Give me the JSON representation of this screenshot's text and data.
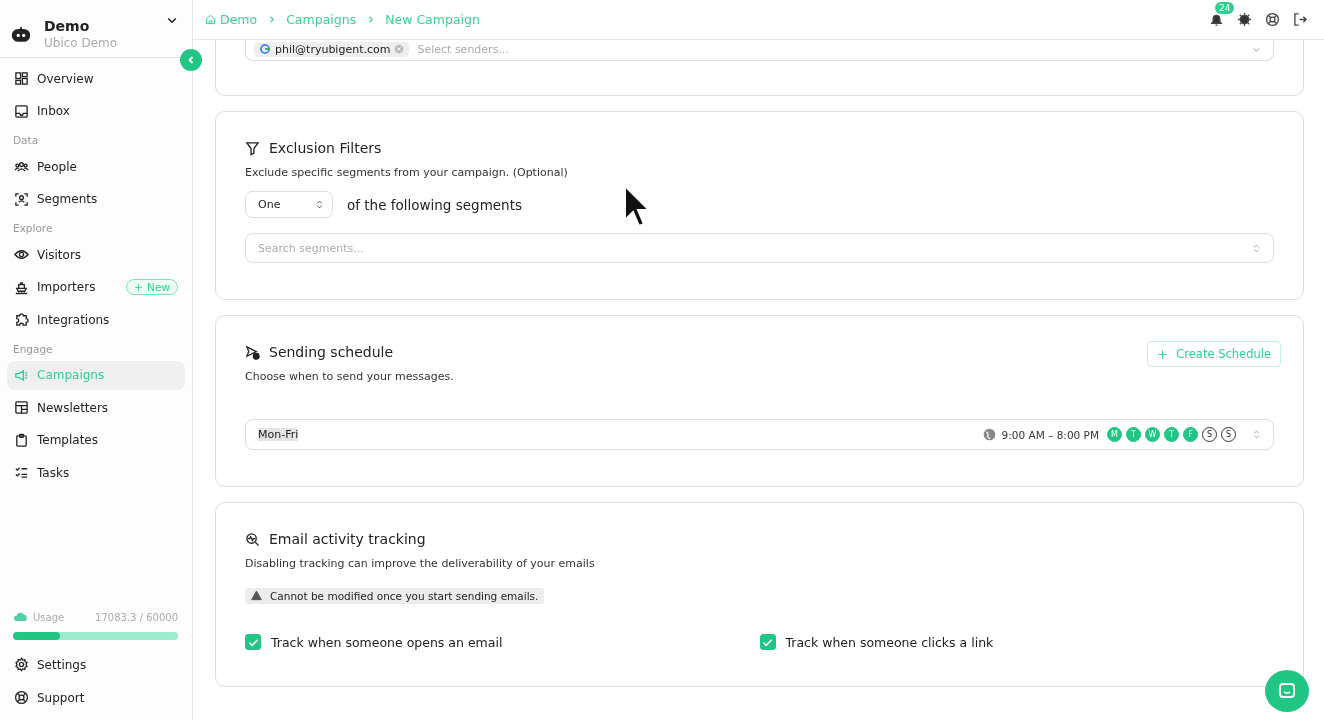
{
  "workspace": {
    "name": "Demo",
    "subtitle": "Ubico Demo"
  },
  "sidebar": {
    "sections": [
      {
        "items": [
          {
            "label": "Overview",
            "selected": false
          },
          {
            "label": "Inbox",
            "selected": false
          }
        ]
      },
      {
        "heading": "Data",
        "items": [
          {
            "label": "People",
            "selected": false
          },
          {
            "label": "Segments",
            "selected": false
          }
        ]
      },
      {
        "heading": "Explore",
        "items": [
          {
            "label": "Visitors",
            "selected": false
          },
          {
            "label": "Importers",
            "selected": false,
            "badge": "New"
          },
          {
            "label": "Integrations",
            "selected": false
          }
        ]
      },
      {
        "heading": "Engage",
        "items": [
          {
            "label": "Campaigns",
            "selected": true
          },
          {
            "label": "Newsletters",
            "selected": false
          },
          {
            "label": "Templates",
            "selected": false
          },
          {
            "label": "Tasks",
            "selected": false
          }
        ]
      }
    ],
    "usage": {
      "label": "Usage",
      "reading": "17083.3 / 60000",
      "level": 0.285
    },
    "footer_items": [
      {
        "label": "Settings"
      },
      {
        "label": "Support"
      }
    ]
  },
  "breadcrumb": [
    "Demo",
    "Campaigns",
    "New Campaign"
  ],
  "notifications": {
    "count": "24"
  },
  "senders": {
    "chips": [
      "phil@tryubigent.com"
    ],
    "placeholder": "Select senders..."
  },
  "exclusion": {
    "title": "Exclusion Filters",
    "description": "Exclude specific segments from your campaign. (Optional)",
    "match": "One",
    "match_suffix": "of the following segments",
    "search_placeholder": "Search segments..."
  },
  "schedule": {
    "title": "Sending schedule",
    "description": "Choose when to send your messages.",
    "button": "Create Schedule",
    "value": "Mon-Fri",
    "hours": "9:00 AM – 8:00 PM",
    "days": [
      {
        "label": "M",
        "selected": true
      },
      {
        "label": "T",
        "selected": true
      },
      {
        "label": "W",
        "selected": true
      },
      {
        "label": "T",
        "selected": true
      },
      {
        "label": "F",
        "selected": true
      },
      {
        "label": "S",
        "selected": false
      },
      {
        "label": "S",
        "selected": false
      }
    ]
  },
  "tracking": {
    "title": "Email activity tracking",
    "description": "Disabling tracking can improve the deliverability of your emails",
    "warning": "Cannot be modified once you start sending emails.",
    "options": [
      {
        "label": "Track when someone opens an email",
        "checked": true
      },
      {
        "label": "Track when someone clicks a link",
        "checked": true
      }
    ]
  }
}
